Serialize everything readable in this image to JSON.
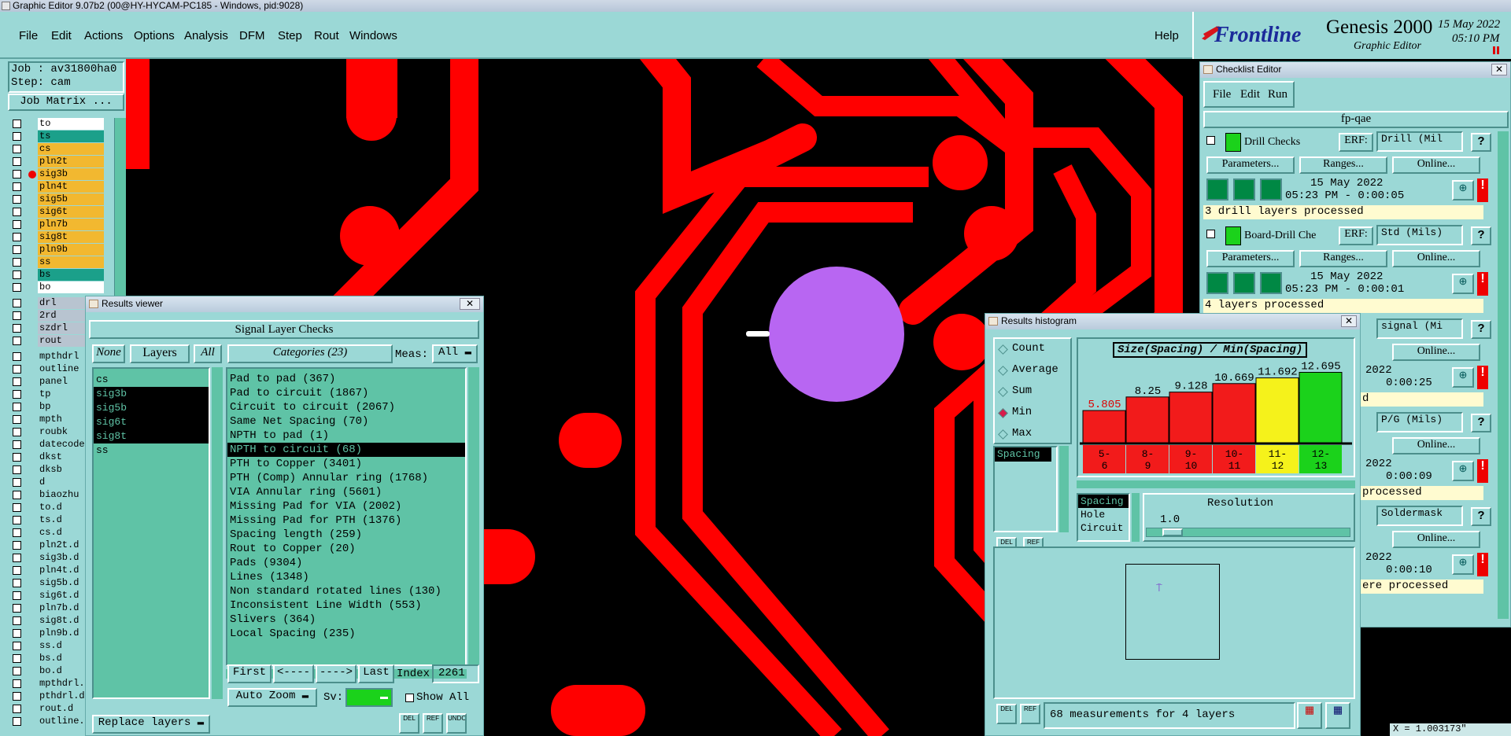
{
  "window": {
    "title": "Graphic Editor 9.07b2 (00@HY-HYCAM-PC185 - Windows, pid:9028)"
  },
  "menu": [
    "File",
    "Edit",
    "Actions",
    "Options",
    "Analysis",
    "DFM",
    "Step",
    "Rout",
    "Windows"
  ],
  "help_label": "Help",
  "brand": {
    "logo": "Frontline",
    "product": "Genesis 2000",
    "subtitle": "Graphic Editor",
    "date": "15 May 2022",
    "time": "05:10 PM"
  },
  "job": {
    "job_label": "Job : av31800ha0",
    "step_label": "Step: cam",
    "matrix_button": "Job Matrix ..."
  },
  "layers": [
    "to",
    "ts",
    "cs",
    "pln2t",
    "sig3b",
    "pln4t",
    "sig5b",
    "sig6t",
    "pln7b",
    "sig8t",
    "pln9b",
    "ss",
    "bs",
    "bo"
  ],
  "layers2": [
    "drl",
    "2rd",
    "szdrl",
    "rout"
  ],
  "layers3": [
    "mpthdrl",
    "outline",
    "panel",
    "tp",
    "bp",
    "mpth",
    "roubk",
    "datecode",
    "dkst",
    "dksb",
    "d",
    "biaozhu",
    "to.d",
    "ts.d",
    "cs.d",
    "pln2t.d",
    "sig3b.d",
    "pln4t.d",
    "sig5b.d",
    "sig6t.d",
    "pln7b.d",
    "sig8t.d",
    "pln9b.d",
    "ss.d",
    "bs.d",
    "bo.d",
    "mpthdrl.",
    "pthdrl.d",
    "rout.d",
    "outline."
  ],
  "results_viewer": {
    "title": "Results viewer",
    "header": "Signal Layer Checks",
    "none_btn": "None",
    "layers_btn": "Layers",
    "all_btn": "All",
    "layer_items": [
      "cs",
      "sig3b",
      "sig5b",
      "sig6t",
      "sig8t",
      "ss"
    ],
    "categories_btn": "Categories (23)",
    "meas_label": "Meas:",
    "meas_value": "All",
    "categories": [
      "Pad to pad (367)",
      "Pad to circuit (1867)",
      "Circuit to circuit (2067)",
      "Same Net Spacing (70)",
      "NPTH to pad (1)",
      "NPTH to circuit (68)",
      "PTH to Copper (3401)",
      "PTH (Comp) Annular ring (1768)",
      "VIA Annular ring (5601)",
      "Missing Pad for VIA (2002)",
      "Missing Pad for PTH (1376)",
      "Spacing length (259)",
      "Rout to Copper (20)",
      "Pads (9304)",
      "Lines (1348)",
      "Non standard rotated lines (130)",
      "Inconsistent Line Width (553)",
      "Slivers (364)",
      "Local Spacing (235)"
    ],
    "first_btn": "First",
    "prev_btn": "<----",
    "next_btn": "---->",
    "last_btn": "Last",
    "index_label": "Index:",
    "index_value": "2261",
    "zoom_btn": "Auto Zoom",
    "sv_label": "Sv:",
    "show_all": "Show All",
    "replace_btn": "Replace layers"
  },
  "histogram": {
    "title": "Results histogram",
    "modes": [
      "Count",
      "Average",
      "Sum",
      "Min",
      "Max"
    ],
    "selected_mode": "Min",
    "chart_title": "Size(Spacing) / Min(Spacing)",
    "list_left": "Spacing",
    "types": [
      "Spacing",
      "Hole",
      "Circuit"
    ],
    "resolution_label": "Resolution",
    "resolution_value": "1.0",
    "status": "68 measurements for 4 layers"
  },
  "chart_data": {
    "type": "bar",
    "title": "Size(Spacing) / Min(Spacing)",
    "categories": [
      "5-6",
      "8-9",
      "9-10",
      "10-11",
      "11-12",
      "12-13"
    ],
    "values": [
      5.805,
      8.25,
      9.128,
      10.669,
      11.692,
      12.695
    ],
    "colors": [
      "#f21b1b",
      "#f21b1b",
      "#f21b1b",
      "#f21b1b",
      "#f5f21b",
      "#1bd21b"
    ]
  },
  "checklist": {
    "title": "Checklist Editor",
    "menu": [
      "File",
      "Edit",
      "Run"
    ],
    "name": "fp-qae",
    "actions": [
      {
        "name": "Drill Checks",
        "erf": "Drill (Mil",
        "date": "15 May 2022",
        "time": "05:23 PM - 0:00:05",
        "status": "3 drill layers processed"
      },
      {
        "name": "Board-Drill Che",
        "erf": "Std (Mils)",
        "date": "15 May 2022",
        "time": "05:23 PM - 0:00:01",
        "status": "4 layers processed"
      }
    ],
    "erf_label": "ERF:",
    "params_btn": "Parameters...",
    "ranges_btn": "Ranges...",
    "online_btn": "Online...",
    "partial": [
      {
        "erf": "signal (Mi",
        "online": "Online...",
        "date": "2022",
        "time": "0:00:25",
        "status": "d"
      },
      {
        "erf": "P/G (Mils)",
        "online": "Online...",
        "date": "2022",
        "time": "0:00:09",
        "status": "processed"
      },
      {
        "erf": "Soldermask",
        "online": "Online...",
        "date": "2022",
        "time": "0:00:10",
        "status": "ere processed"
      }
    ]
  },
  "coords": "X = 1.003173\""
}
